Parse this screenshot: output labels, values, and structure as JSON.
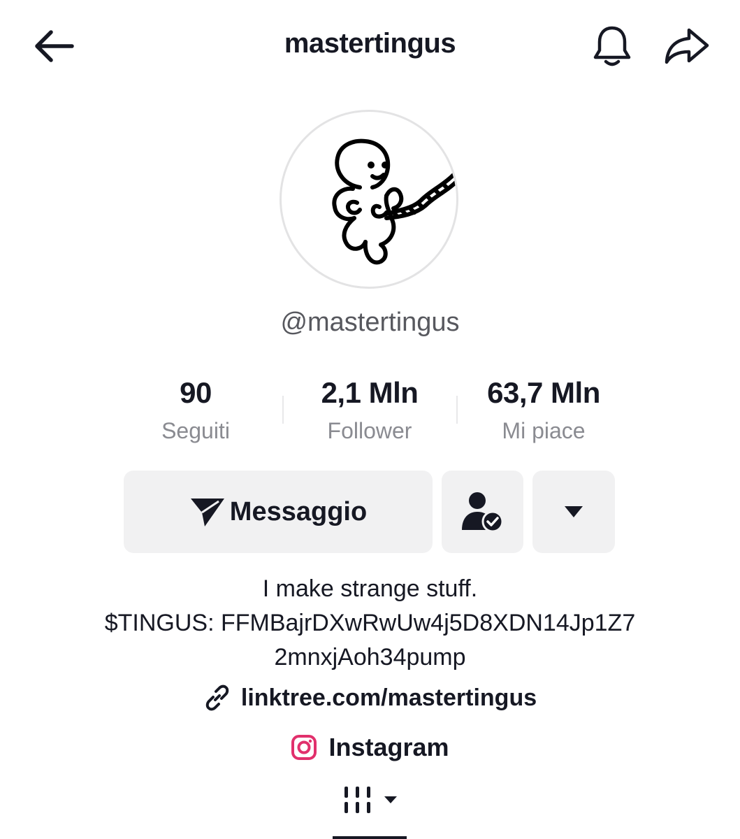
{
  "header": {
    "username": "mastertingus",
    "back_icon": "arrow-left-icon",
    "notification_icon": "bell-icon",
    "share_icon": "share-arrow-icon"
  },
  "profile": {
    "avatar_icon": "doodle-character-icon",
    "handle": "@mastertingus"
  },
  "stats": [
    {
      "value": "90",
      "label": "Seguiti"
    },
    {
      "value": "2,1 Mln",
      "label": "Follower"
    },
    {
      "value": "63,7 Mln",
      "label": "Mi piace"
    }
  ],
  "actions": {
    "message_label": "Messaggio",
    "message_icon": "send-icon",
    "friend_icon": "user-check-icon",
    "more_icon": "caret-down-icon"
  },
  "bio": {
    "lines": [
      "I make strange stuff.",
      "$TINGUS: FFMBajrDXwRwUw4j5D8XDN14Jp1Z7",
      "2mnxjAoh34pump"
    ]
  },
  "link": {
    "icon": "link-icon",
    "text": "linktree.com/mastertingus"
  },
  "instagram": {
    "icon": "instagram-icon",
    "text": "Instagram",
    "color": "#e1306c"
  },
  "tabs": {
    "active_icon": "grid-lines-icon",
    "dropdown_icon": "caret-down-icon"
  }
}
